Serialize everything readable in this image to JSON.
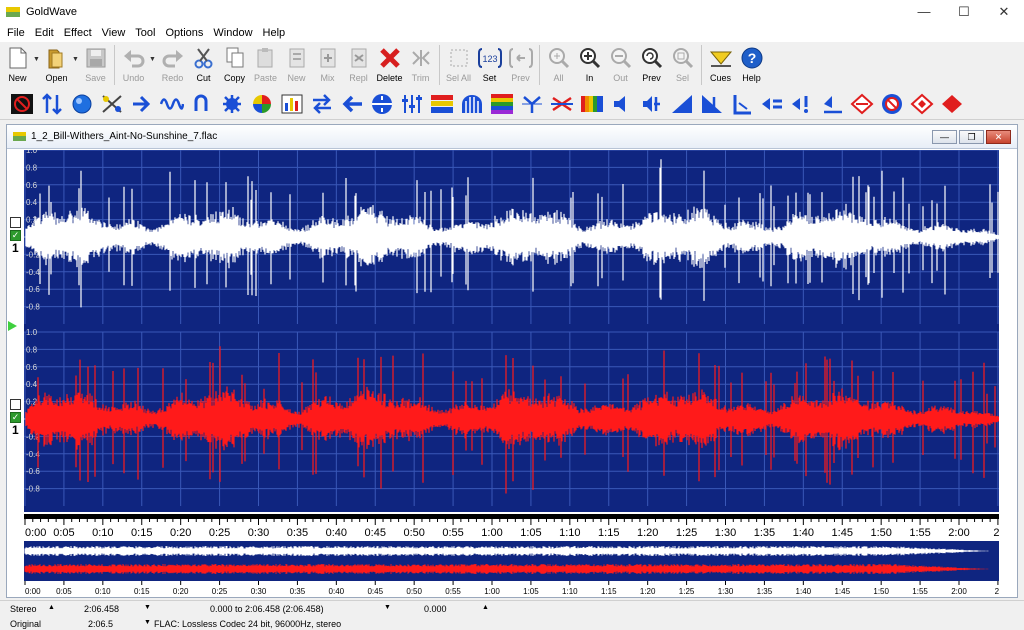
{
  "window": {
    "title": "GoldWave",
    "minimize": "—",
    "maximize": "☐",
    "close": "✕"
  },
  "menu": [
    "File",
    "Edit",
    "Effect",
    "View",
    "Tool",
    "Options",
    "Window",
    "Help"
  ],
  "toolbar": [
    {
      "label": "New",
      "icon": "new-file-icon",
      "enabled": true
    },
    {
      "label": "Open",
      "icon": "open-folder-icon",
      "enabled": true
    },
    {
      "label": "Save",
      "icon": "save-icon",
      "enabled": false
    },
    {
      "label": "Undo",
      "icon": "undo-icon",
      "enabled": false
    },
    {
      "label": "Redo",
      "icon": "redo-icon",
      "enabled": false
    },
    {
      "label": "Cut",
      "icon": "scissors-icon",
      "enabled": true
    },
    {
      "label": "Copy",
      "icon": "copy-icon",
      "enabled": true
    },
    {
      "label": "Paste",
      "icon": "paste-icon",
      "enabled": false
    },
    {
      "label": "New",
      "icon": "paste-new-icon",
      "enabled": false
    },
    {
      "label": "Mix",
      "icon": "mix-icon",
      "enabled": false
    },
    {
      "label": "Repl",
      "icon": "replace-icon",
      "enabled": false
    },
    {
      "label": "Delete",
      "icon": "delete-icon",
      "enabled": true
    },
    {
      "label": "Trim",
      "icon": "trim-icon",
      "enabled": false
    },
    {
      "label": "Sel All",
      "icon": "select-all-icon",
      "enabled": false
    },
    {
      "label": "Set",
      "icon": "set-selection-icon",
      "enabled": true
    },
    {
      "label": "Prev",
      "icon": "previous-selection-icon",
      "enabled": false
    },
    {
      "label": "All",
      "icon": "zoom-all-icon",
      "enabled": false
    },
    {
      "label": "In",
      "icon": "zoom-in-icon",
      "enabled": true
    },
    {
      "label": "Out",
      "icon": "zoom-out-icon",
      "enabled": false
    },
    {
      "label": "Prev",
      "icon": "zoom-previous-icon",
      "enabled": true
    },
    {
      "label": "Sel",
      "icon": "zoom-selection-icon",
      "enabled": false
    },
    {
      "label": "Cues",
      "icon": "cues-icon",
      "enabled": true
    },
    {
      "label": "Help",
      "icon": "help-icon",
      "enabled": true
    }
  ],
  "effect_toolbar": [
    "block-icon",
    "resize-icon",
    "sphere-icon",
    "equalizer-cross-icon",
    "forward-arrow-icon",
    "wave-icon",
    "loop-back-icon",
    "gear-icon",
    "color-circle-icon",
    "bars-chart-icon",
    "swap-arrows-icon",
    "left-arrow-icon",
    "split-circle-icon",
    "sliders-icon",
    "spectrum-bars-icon",
    "dome-bars-icon",
    "color-grid-icon",
    "spread-arrows-icon",
    "cross-arrows-icon",
    "rainbow-icon",
    "speaker-icon",
    "speaker-split-icon",
    "volume-up-icon",
    "volume-down-icon",
    "flag-marker-icon",
    "speaker-equal-icon",
    "speaker-warn-icon",
    "speaker-low-icon",
    "diamond-arrow-icon",
    "noise-block-icon",
    "diamond-red-icon",
    "diamond-corner-icon"
  ],
  "document": {
    "title": "1_2_Bill-Withers_Aint-No-Sunshine_7.flac",
    "duration_seconds": 126.458,
    "channels": [
      {
        "label": "1",
        "color": "#ffffff"
      },
      {
        "label": "1",
        "color": "#ff1a1a"
      }
    ],
    "amplitude_ticks": [
      "1.0",
      "0.8",
      "0.6",
      "0.4",
      "0.2",
      "0.0",
      "-0.2",
      "-0.4",
      "-0.6",
      "-0.8"
    ],
    "time_ticks": [
      "0:00",
      "0:05",
      "0:10",
      "0:15",
      "0:20",
      "0:25",
      "0:30",
      "0:35",
      "0:40",
      "0:45",
      "0:50",
      "0:55",
      "1:00",
      "1:05",
      "1:10",
      "1:15",
      "1:20",
      "1:25",
      "1:30",
      "1:35",
      "1:40",
      "1:45",
      "1:50",
      "1:55",
      "2:00",
      "2:"
    ],
    "background_color": "#0f2580",
    "grid_color": "#3a58b8"
  },
  "status": {
    "row1": {
      "channels": "Stereo",
      "length": "2:06.458",
      "selection": "0.000 to 2:06.458 (2:06.458)",
      "position": "0.000"
    },
    "row2": {
      "mode": "Original",
      "original_length": "2:06.5",
      "format": "FLAC: Lossless Codec 24 bit, 96000Hz, stereo"
    }
  }
}
